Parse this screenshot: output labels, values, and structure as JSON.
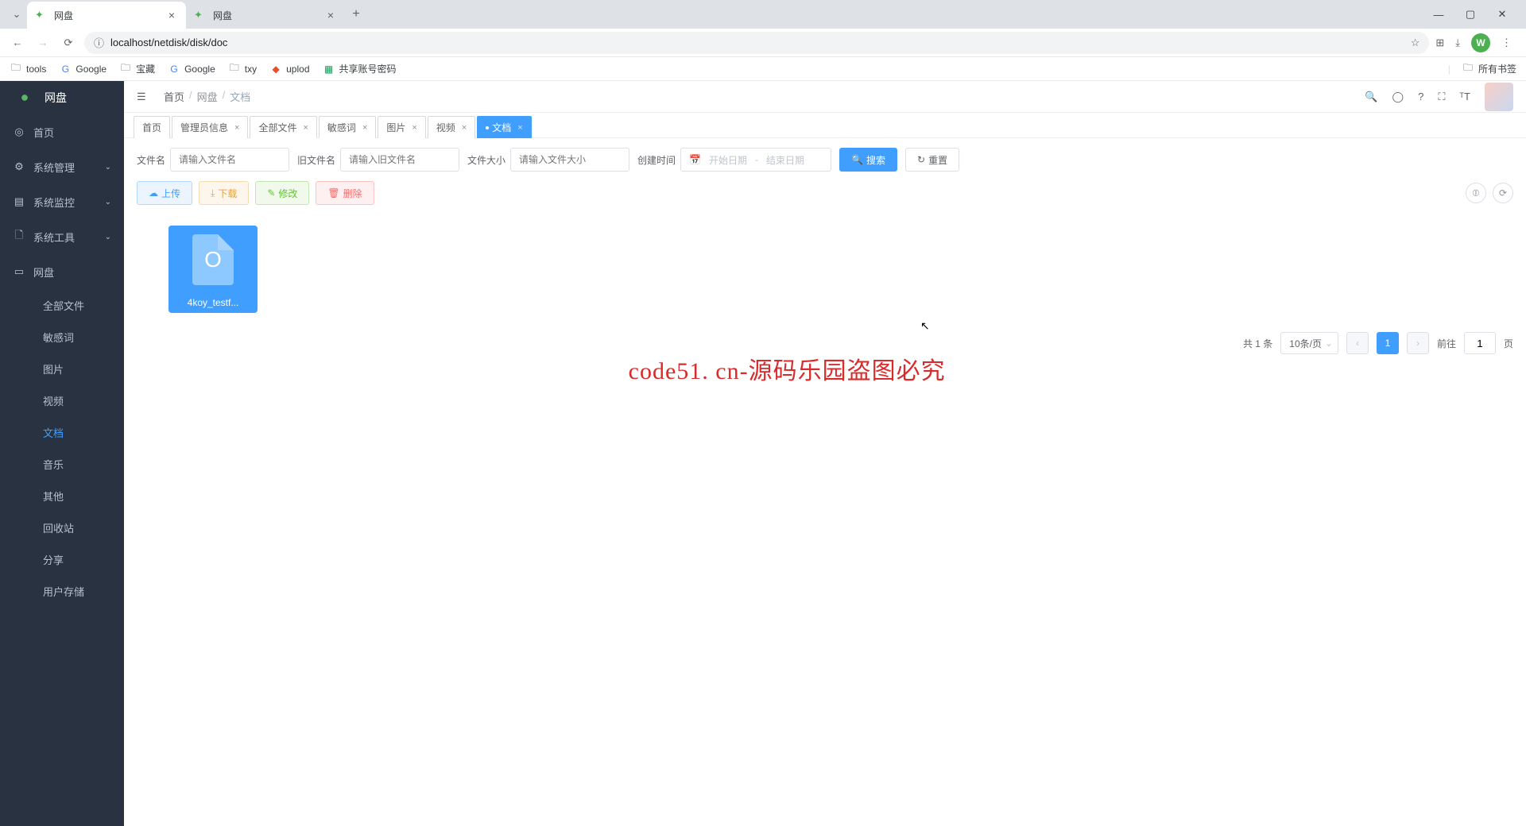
{
  "browser": {
    "tabs": [
      {
        "title": "网盘",
        "active": true
      },
      {
        "title": "网盘",
        "active": false
      }
    ],
    "url": "localhost/netdisk/disk/doc",
    "avatar_letter": "W",
    "bookmarks": [
      "tools",
      "Google",
      "宝藏",
      "Google",
      "txy",
      "uplod",
      "共享账号密码"
    ],
    "all_bookmarks_label": "所有书签"
  },
  "sidebar": {
    "logo": "网盘",
    "items": [
      {
        "icon": "◎",
        "label": "首页",
        "expandable": false
      },
      {
        "icon": "⚙",
        "label": "系统管理",
        "expandable": true
      },
      {
        "icon": "▤",
        "label": "系统监控",
        "expandable": true
      },
      {
        "icon": "🗋",
        "label": "系统工具",
        "expandable": true
      },
      {
        "icon": "▭",
        "label": "网盘",
        "expandable": false
      }
    ],
    "subitems": [
      "全部文件",
      "敏感词",
      "图片",
      "视频",
      "文档",
      "音乐",
      "其他",
      "回收站",
      "分享",
      "用户存储"
    ],
    "active_sub": "文档"
  },
  "breadcrumb": {
    "items": [
      "首页",
      "网盘",
      "文档"
    ]
  },
  "tabs": [
    {
      "label": "首页",
      "closable": false,
      "active": false
    },
    {
      "label": "管理员信息",
      "closable": true,
      "active": false
    },
    {
      "label": "全部文件",
      "closable": true,
      "active": false
    },
    {
      "label": "敏感词",
      "closable": true,
      "active": false
    },
    {
      "label": "图片",
      "closable": true,
      "active": false
    },
    {
      "label": "视频",
      "closable": true,
      "active": false
    },
    {
      "label": "文档",
      "closable": true,
      "active": true
    }
  ],
  "search": {
    "filename_label": "文件名",
    "filename_placeholder": "请输入文件名",
    "oldname_label": "旧文件名",
    "oldname_placeholder": "请输入旧文件名",
    "size_label": "文件大小",
    "size_placeholder": "请输入文件大小",
    "created_label": "创建时间",
    "date_start": "开始日期",
    "date_sep": "-",
    "date_end": "结束日期",
    "search_btn": "搜索",
    "reset_btn": "重置"
  },
  "actions": {
    "upload": "上传",
    "download": "下载",
    "modify": "修改",
    "delete": "删除"
  },
  "files": [
    {
      "name": "4koy_testf..."
    }
  ],
  "pagination": {
    "total_text": "共 1 条",
    "page_size": "10条/页",
    "current": "1",
    "goto_label": "前往",
    "goto_value": "1",
    "page_suffix": "页"
  },
  "watermark": "code51. cn-源码乐园盗图必究"
}
